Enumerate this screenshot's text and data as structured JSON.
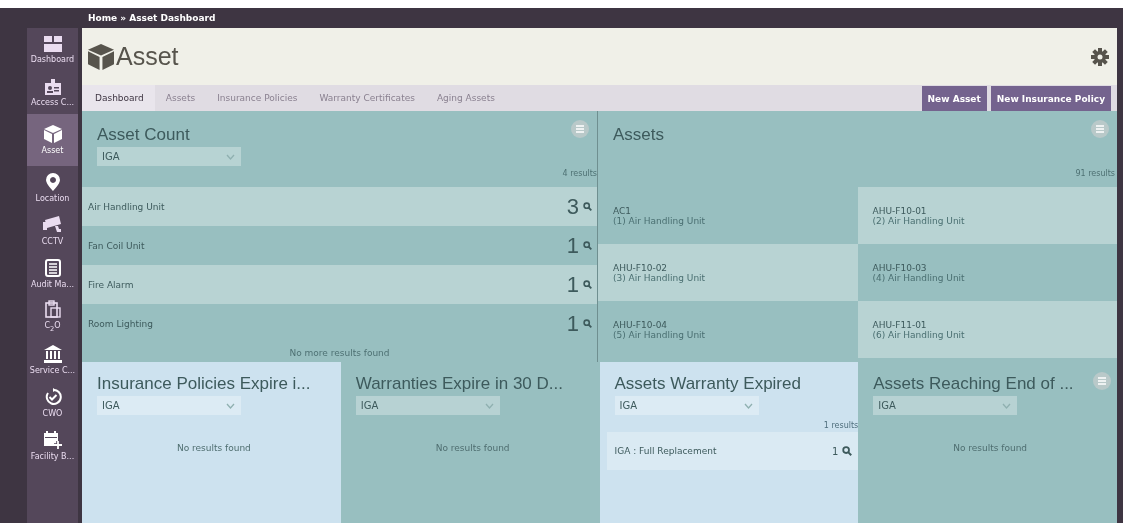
{
  "breadcrumb": "Home  » Asset Dashboard",
  "sidebar": {
    "items": [
      {
        "label": "Dashboard",
        "kind": "dashboard",
        "selected": false
      },
      {
        "label": "Access C...",
        "kind": "badge",
        "selected": false
      },
      {
        "label": "Asset",
        "kind": "cube",
        "selected": true
      },
      {
        "label": "Location",
        "kind": "pin",
        "selected": false
      },
      {
        "label": "CCTV",
        "kind": "camera",
        "selected": false
      },
      {
        "label": "Audit Ma...",
        "kind": "document",
        "selected": false
      },
      {
        "label": "C$_{2}$O",
        "kind": "clipboard",
        "selected": false
      },
      {
        "label": "Service C...",
        "kind": "bank",
        "selected": false
      },
      {
        "label": "CWO",
        "kind": "refresh",
        "selected": false
      },
      {
        "label": "Facility B...",
        "kind": "calendar",
        "selected": false
      }
    ]
  },
  "header": {
    "title": "Asset"
  },
  "tabs": [
    {
      "label": "Dashboard",
      "selected": true
    },
    {
      "label": "Assets",
      "selected": false
    },
    {
      "label": "Insurance Policies",
      "selected": false
    },
    {
      "label": "Warranty Certificates",
      "selected": false
    },
    {
      "label": "Aging Assets",
      "selected": false
    }
  ],
  "buttons": [
    "New Asset",
    "New Insurance Policy"
  ],
  "asset_count": {
    "title": "Asset Count",
    "filter": "IGA",
    "results": "4 results",
    "menu": true,
    "rows": [
      {
        "name": "Air Handling Unit",
        "count": "3"
      },
      {
        "name": "Fan Coil Unit",
        "count": "1"
      },
      {
        "name": "Fire Alarm",
        "count": "1"
      },
      {
        "name": "Room Lighting",
        "count": "1"
      }
    ],
    "footer": "No more results found"
  },
  "assets": {
    "title": "Assets",
    "results": "91 results",
    "menu": true,
    "items": [
      {
        "code": "AC1",
        "type": "(1) Air Handling Unit"
      },
      {
        "code": "AHU-F10-01",
        "type": "(2) Air Handling Unit"
      },
      {
        "code": "AHU-F10-02",
        "type": "(3) Air Handling Unit"
      },
      {
        "code": "AHU-F10-03",
        "type": "(4) Air Handling Unit"
      },
      {
        "code": "AHU-F10-04",
        "type": "(5) Air Handling Unit"
      },
      {
        "code": "AHU-F11-01",
        "type": "(6) Air Handling Unit"
      }
    ]
  },
  "bottom_panels": [
    {
      "title": "Insurance Policies Expire i...",
      "filter": "IGA",
      "color": "#cde2ef",
      "menu": false,
      "empty": "No results found"
    },
    {
      "title": "Warranties Expire in 30 D...",
      "filter": "IGA",
      "color": "#98bfc0",
      "menu": false,
      "empty": "No results found"
    },
    {
      "title": "Assets Warranty Expired",
      "filter": "IGA",
      "color": "#cde2ef",
      "menu": false,
      "results": "1 results",
      "rows": [
        {
          "name": "IGA : Full Replacement",
          "count": "1"
        }
      ]
    },
    {
      "title": "Assets Reaching End of ...",
      "filter": "IGA",
      "color": "#98bfc0",
      "menu": true,
      "empty": "No results found"
    }
  ]
}
